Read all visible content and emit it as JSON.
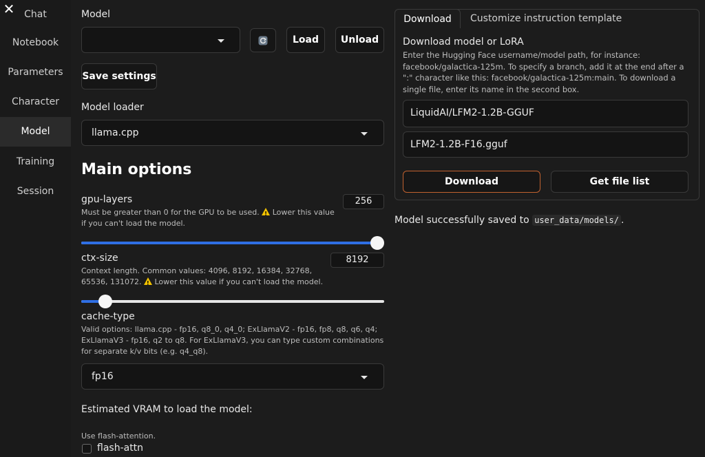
{
  "sidebar": {
    "close_glyph": "✕",
    "items": [
      {
        "label": "Chat"
      },
      {
        "label": "Notebook"
      },
      {
        "label": "Parameters"
      },
      {
        "label": "Character"
      },
      {
        "label": "Model",
        "active": true
      },
      {
        "label": "Training"
      },
      {
        "label": "Session"
      }
    ]
  },
  "model": {
    "label": "Model",
    "selected": "",
    "refresh_icon": "refresh-icon",
    "load_label": "Load",
    "unload_label": "Unload",
    "save_settings_label": "Save settings"
  },
  "loader": {
    "label": "Model loader",
    "selected": "llama.cpp"
  },
  "main_options": {
    "heading": "Main options",
    "gpu_layers": {
      "label": "gpu-layers",
      "value": "256",
      "help_a": "Must be greater than 0 for the GPU to be used.",
      "help_b": "Lower this value if you can't load the model.",
      "slider_fraction": 1.0
    },
    "ctx_size": {
      "label": "ctx-size",
      "value": "8192",
      "help_a": "Context length. Common values: 4096, 8192, 16384, 32768, 65536, 131072.",
      "help_b": "Lower this value if you can't load the model.",
      "slider_fraction": 0.08
    },
    "cache_type": {
      "label": "cache-type",
      "help": "Valid options: llama.cpp - fp16, q8_0, q4_0; ExLlamaV2 - fp16, fp8, q8, q6, q4; ExLlamaV3 - fp16, q2 to q8. For ExLlamaV3, you can type custom combinations for separate k/v bits (e.g. q4_q8).",
      "selected": "fp16"
    },
    "vram_label": "Estimated VRAM to load the model:",
    "flash_attn_help": "Use flash-attention.",
    "flash_attn_label": "flash-attn"
  },
  "download_panel": {
    "tabs": [
      "Download",
      "Customize instruction template"
    ],
    "title": "Download model or LoRA",
    "help": "Enter the Hugging Face username/model path, for instance: facebook/galactica-125m. To specify a branch, add it at the end after a \":\" character like this: facebook/galactica-125m:main. To download a single file, enter its name in the second box.",
    "repo_value": "LiquidAI/LFM2-1.2B-GGUF",
    "file_value": "LFM2-1.2B-F16.gguf",
    "download_label": "Download",
    "file_list_label": "Get file list"
  },
  "status": {
    "prefix": "Model successfully saved to",
    "path": "user_data/models/",
    "suffix": "."
  },
  "colors": {
    "accent_blue": "#2f6fe4",
    "download_border": "#c2622f",
    "warning": "#f2c200"
  }
}
